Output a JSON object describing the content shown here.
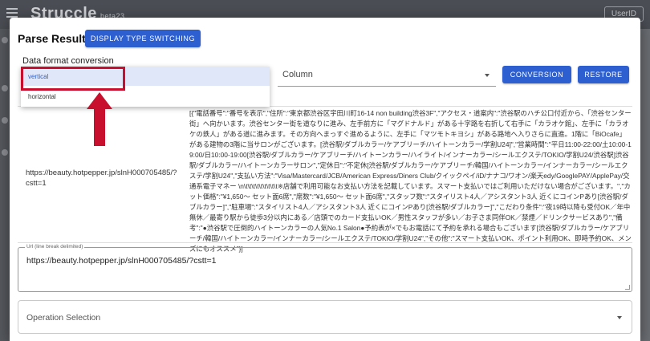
{
  "app": {
    "brand": "Struccle",
    "version": "beta23",
    "user_button": "UserID"
  },
  "modal": {
    "title": "Parse Result",
    "switch_button": "DISPLAY TYPE SWITCHING"
  },
  "format": {
    "label": "Data format conversion",
    "options": [
      "vertical",
      "horizontal"
    ],
    "selected": "vertical",
    "column_select": "Column",
    "conversion_button": "CONVERSION",
    "restore_button": "RESTORE"
  },
  "result": {
    "url": "https://beauty.hotpepper.jp/slnH000705485/?cstt=1",
    "data": "[{\"電話番号\":\"番号を表示\",\"住所\":\"東京都渋谷区宇田川町16-14 non building渋谷3F\",\"アクセス・道案内\":\"渋谷駅のハチ公口付近から、「渋谷センター街」へ向かいます。渋谷センター街を道なりに進み、左手前方に「マグドナルド」がある十字路を右折して右手に「カラオケ館」、左手に「カラオケの鉄人」がある道に進みます。その方向へまっすぐ進めるように、左手に「マツモトキヨシ」がある路地へ入りさらに直進。1階に「BiOcafe」がある建物の3階に当サロンがございます。[渋谷駅/ダブルカラー/ケアブリーチ/ハイトーンカラー/学割U24]\",\"営業時間\":\"平日11:00-22:00/土10:00-19:00/日10:00-19:00[渋谷駅/ダブルカラー/ケアブリーチ/ハイトーンカラー/ハイライト/インナーカラー/シールエクステ/TOKIO/学割U24/渋谷駅]渋谷駅/ダブルカラー/ハイトーンカラーサロン\",\"定休日\":\"不定休[渋谷駅/ダブルカラー/ケアブリーチ/韓国/ハイトーンカラー/インナーカラー/シールエクステ/学割U24\",\"支払い方法\":\"Visa/Mastercard/JCB/American Express/Diners Club/クイックペイ/iD/ナナコ/ワオン/楽天edy/GooglePAY/ApplePay/交通系電子マネー \\n\\t\\t\\t\\t\\t\\t\\t\\t\\t※店舗で利用可能なお支払い方法を記載しています。スマート支払いではご利用いただけない場合がございます。\",\"カット価格\":\"¥1,650～ セット面6席\",\"席数\":\"¥1,650～ セット面6席\",\"スタッフ数\":\"スタイリスト4人／アシスタント3人 近くにコインPあり[渋谷駅/ダブルカラー]\",\"駐車場\":\"スタイリスト4人／アシスタント3人 近くにコインPあり[渋谷駅/ダブルカラー]\",\"こだわり条件\":\"夜19時以降も受付OK／年中無休／最寄り駅から徒歩3分以内にある／店頭でのカード支払いOK／男性スタッフが多い／お子さま同伴OK／禁煙／ドリンクサービスあり\",\"備考\":\"●渋谷駅で圧倒的ハイトーンカラーの人気No.1 Salon●予約表が×でもお電話にて予約を承れる場合もございます[渋谷駅/ダブルカラー/ケアブリーチ/韓国/ハイトーンカラー/インナーカラー/シールエクステ/TOKIO/学割U24\",\"その他\":\"スマート支払いOK、ポイント利用OK、即時予約OK、メンズにもオススメ\"}]"
  },
  "url_input": {
    "legend": "Url (line break delimited)",
    "value": "https://beauty.hotpepper.jp/slnH000705485/?cstt=1"
  },
  "operation": {
    "placeholder": "Operation Selection"
  },
  "colors": {
    "primary": "#2d5fd0",
    "annotation": "#c8102e",
    "selected_bg": "#dfe7f8"
  }
}
